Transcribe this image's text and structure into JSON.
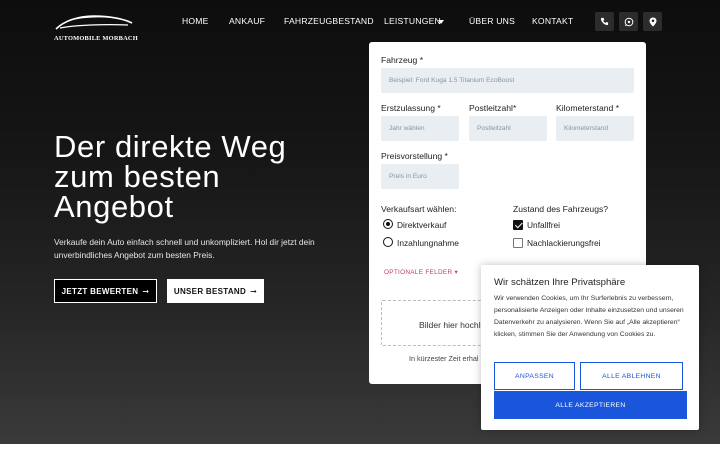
{
  "brand": {
    "name": "AUTOMOBILE MORBACH"
  },
  "nav": {
    "items": [
      {
        "label": "HOME"
      },
      {
        "label": "ANKAUF"
      },
      {
        "label": "FAHRZEUGBESTAND"
      },
      {
        "label": "LEISTUNGEN"
      },
      {
        "label": "ÜBER UNS"
      },
      {
        "label": "KONTAKT"
      }
    ],
    "icons": [
      "phone-icon",
      "whatsapp-icon",
      "location-icon"
    ]
  },
  "hero": {
    "title_line1": "Der direkte Weg",
    "title_line2": "zum besten",
    "title_line3": "Angebot",
    "subtitle": "Verkaufe dein Auto einfach schnell und unkompliziert. Hol dir jetzt dein unverbindliches Angebot zum besten Preis.",
    "cta_primary": "JETZT BEWERTEN",
    "cta_secondary": "UNSER BESTAND",
    "arrow": "➞"
  },
  "form": {
    "vehicle": {
      "label": "Fahrzeug *",
      "placeholder": "Beispiel: Ford Kuga 1.5 Titanium EcoBoost"
    },
    "registration": {
      "label": "Erstzulassung *",
      "placeholder": "Jahr wählen"
    },
    "zip": {
      "label": "Postleitzahl*",
      "placeholder": "Postleitzahl"
    },
    "mileage": {
      "label": "Kilometerstand *",
      "placeholder": "Kilometerstand"
    },
    "price": {
      "label": "Preisvorstellung *",
      "placeholder": "Preis in Euro"
    },
    "sale_type": {
      "label": "Verkaufsart wählen:",
      "options": [
        {
          "label": "Direktverkauf",
          "selected": true
        },
        {
          "label": "Inzahlungnahme",
          "selected": false
        }
      ]
    },
    "condition": {
      "label": "Zustand des Fahrzeugs?",
      "options": [
        {
          "label": "Unfallfrei",
          "checked": true
        },
        {
          "label": "Nachlackierungsfrei",
          "checked": false
        }
      ]
    },
    "optional_fields": "OPTIONALE FELDER ▾",
    "upload_text": "Bilder hier hochla",
    "upload_note": "In kürzester Zeit erhal"
  },
  "cookie": {
    "title": "Wir schätzen Ihre Privatsphäre",
    "body": "Wir verwenden Cookies, um Ihr Surferlebnis zu verbessern, personalisierte Anzeigen oder Inhalte einzusetzen und unseren Datenverkehr zu analysieren. Wenn Sie auf „Alle akzeptieren“ klicken, stimmen Sie der Anwendung von Cookies zu.",
    "customize": "ANPASSEN",
    "reject": "ALLE ABLEHNEN",
    "accept": "ALLE AKZEPTIEREN"
  },
  "colors": {
    "accent": "#1a56db",
    "optional_link": "#c0397a",
    "input_bg": "#e8eef2"
  }
}
